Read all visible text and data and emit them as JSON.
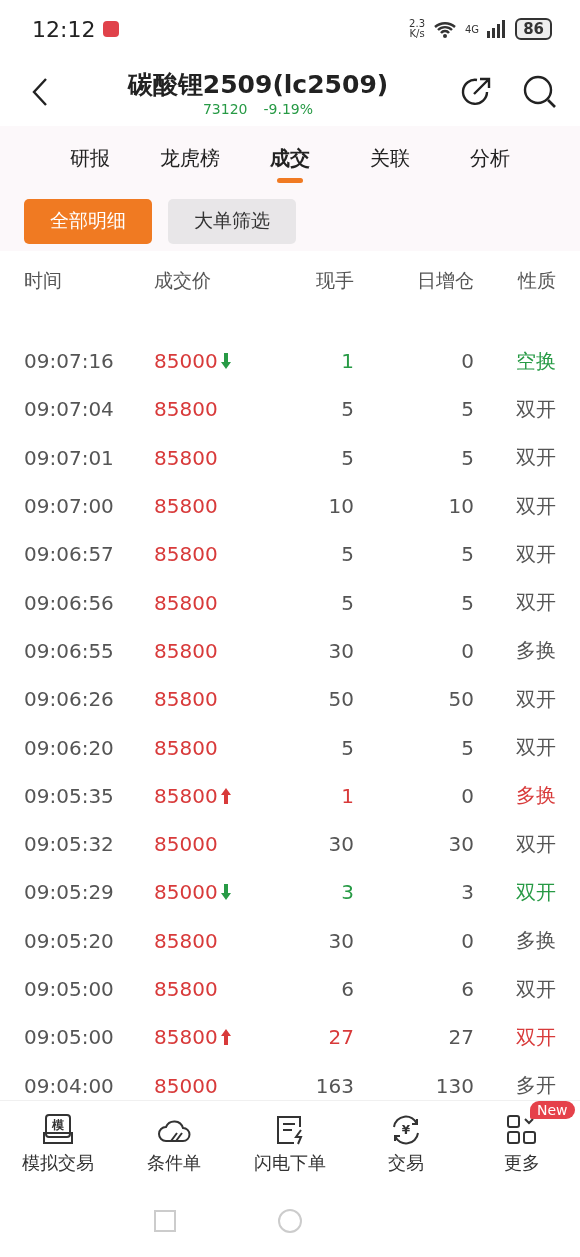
{
  "status_bar": {
    "time": "12:12",
    "speed_value": "2.3",
    "speed_unit": "K/s",
    "network": "4G",
    "battery": "86"
  },
  "header": {
    "title": "碳酸锂2509(lc2509)",
    "price": "73120",
    "change": "-9.19%"
  },
  "tabs": [
    {
      "label": "研报",
      "selected": false
    },
    {
      "label": "龙虎榜",
      "selected": false
    },
    {
      "label": "成交",
      "selected": true
    },
    {
      "label": "关联",
      "selected": false
    },
    {
      "label": "分析",
      "selected": false
    }
  ],
  "filters": [
    {
      "label": "全部明细",
      "selected": true
    },
    {
      "label": "大单筛选",
      "selected": false
    }
  ],
  "table": {
    "columns": [
      "时间",
      "成交价",
      "现手",
      "日增仓",
      "性质"
    ],
    "rows": [
      {
        "time": "09:07:16",
        "price": "85000",
        "up": false,
        "down": true,
        "hands": "1",
        "oi": "0",
        "nature": "空换"
      },
      {
        "time": "09:07:04",
        "price": "85800",
        "up": false,
        "down": false,
        "hands": "5",
        "oi": "5",
        "nature": "双开"
      },
      {
        "time": "09:07:01",
        "price": "85800",
        "up": false,
        "down": false,
        "hands": "5",
        "oi": "5",
        "nature": "双开"
      },
      {
        "time": "09:07:00",
        "price": "85800",
        "up": false,
        "down": false,
        "hands": "10",
        "oi": "10",
        "nature": "双开"
      },
      {
        "time": "09:06:57",
        "price": "85800",
        "up": false,
        "down": false,
        "hands": "5",
        "oi": "5",
        "nature": "双开"
      },
      {
        "time": "09:06:56",
        "price": "85800",
        "up": false,
        "down": false,
        "hands": "5",
        "oi": "5",
        "nature": "双开"
      },
      {
        "time": "09:06:55",
        "price": "85800",
        "up": false,
        "down": false,
        "hands": "30",
        "oi": "0",
        "nature": "多换"
      },
      {
        "time": "09:06:26",
        "price": "85800",
        "up": false,
        "down": false,
        "hands": "50",
        "oi": "50",
        "nature": "双开"
      },
      {
        "time": "09:06:20",
        "price": "85800",
        "up": false,
        "down": false,
        "hands": "5",
        "oi": "5",
        "nature": "双开"
      },
      {
        "time": "09:05:35",
        "price": "85800",
        "up": true,
        "down": false,
        "hands": "1",
        "oi": "0",
        "nature": "多换"
      },
      {
        "time": "09:05:32",
        "price": "85000",
        "up": false,
        "down": false,
        "hands": "30",
        "oi": "30",
        "nature": "双开"
      },
      {
        "time": "09:05:29",
        "price": "85000",
        "up": false,
        "down": true,
        "hands": "3",
        "oi": "3",
        "nature": "双开"
      },
      {
        "time": "09:05:20",
        "price": "85800",
        "up": false,
        "down": false,
        "hands": "30",
        "oi": "0",
        "nature": "多换"
      },
      {
        "time": "09:05:00",
        "price": "85800",
        "up": false,
        "down": false,
        "hands": "6",
        "oi": "6",
        "nature": "双开"
      },
      {
        "time": "09:05:00",
        "price": "85800",
        "up": true,
        "down": false,
        "hands": "27",
        "oi": "27",
        "nature": "双开"
      },
      {
        "time": "09:04:00",
        "price": "85000",
        "up": false,
        "down": false,
        "hands": "163",
        "oi": "130",
        "nature": "多开"
      }
    ]
  },
  "bottom_nav": [
    {
      "kind": "sim",
      "icon_text": "模",
      "label": "模拟交易"
    },
    {
      "kind": "cloud",
      "label": "条件单"
    },
    {
      "kind": "flash",
      "label": "闪电下单"
    },
    {
      "kind": "trade",
      "icon_text": "¥",
      "label": "交易"
    },
    {
      "kind": "grid",
      "label": "更多",
      "badge": "New"
    }
  ]
}
